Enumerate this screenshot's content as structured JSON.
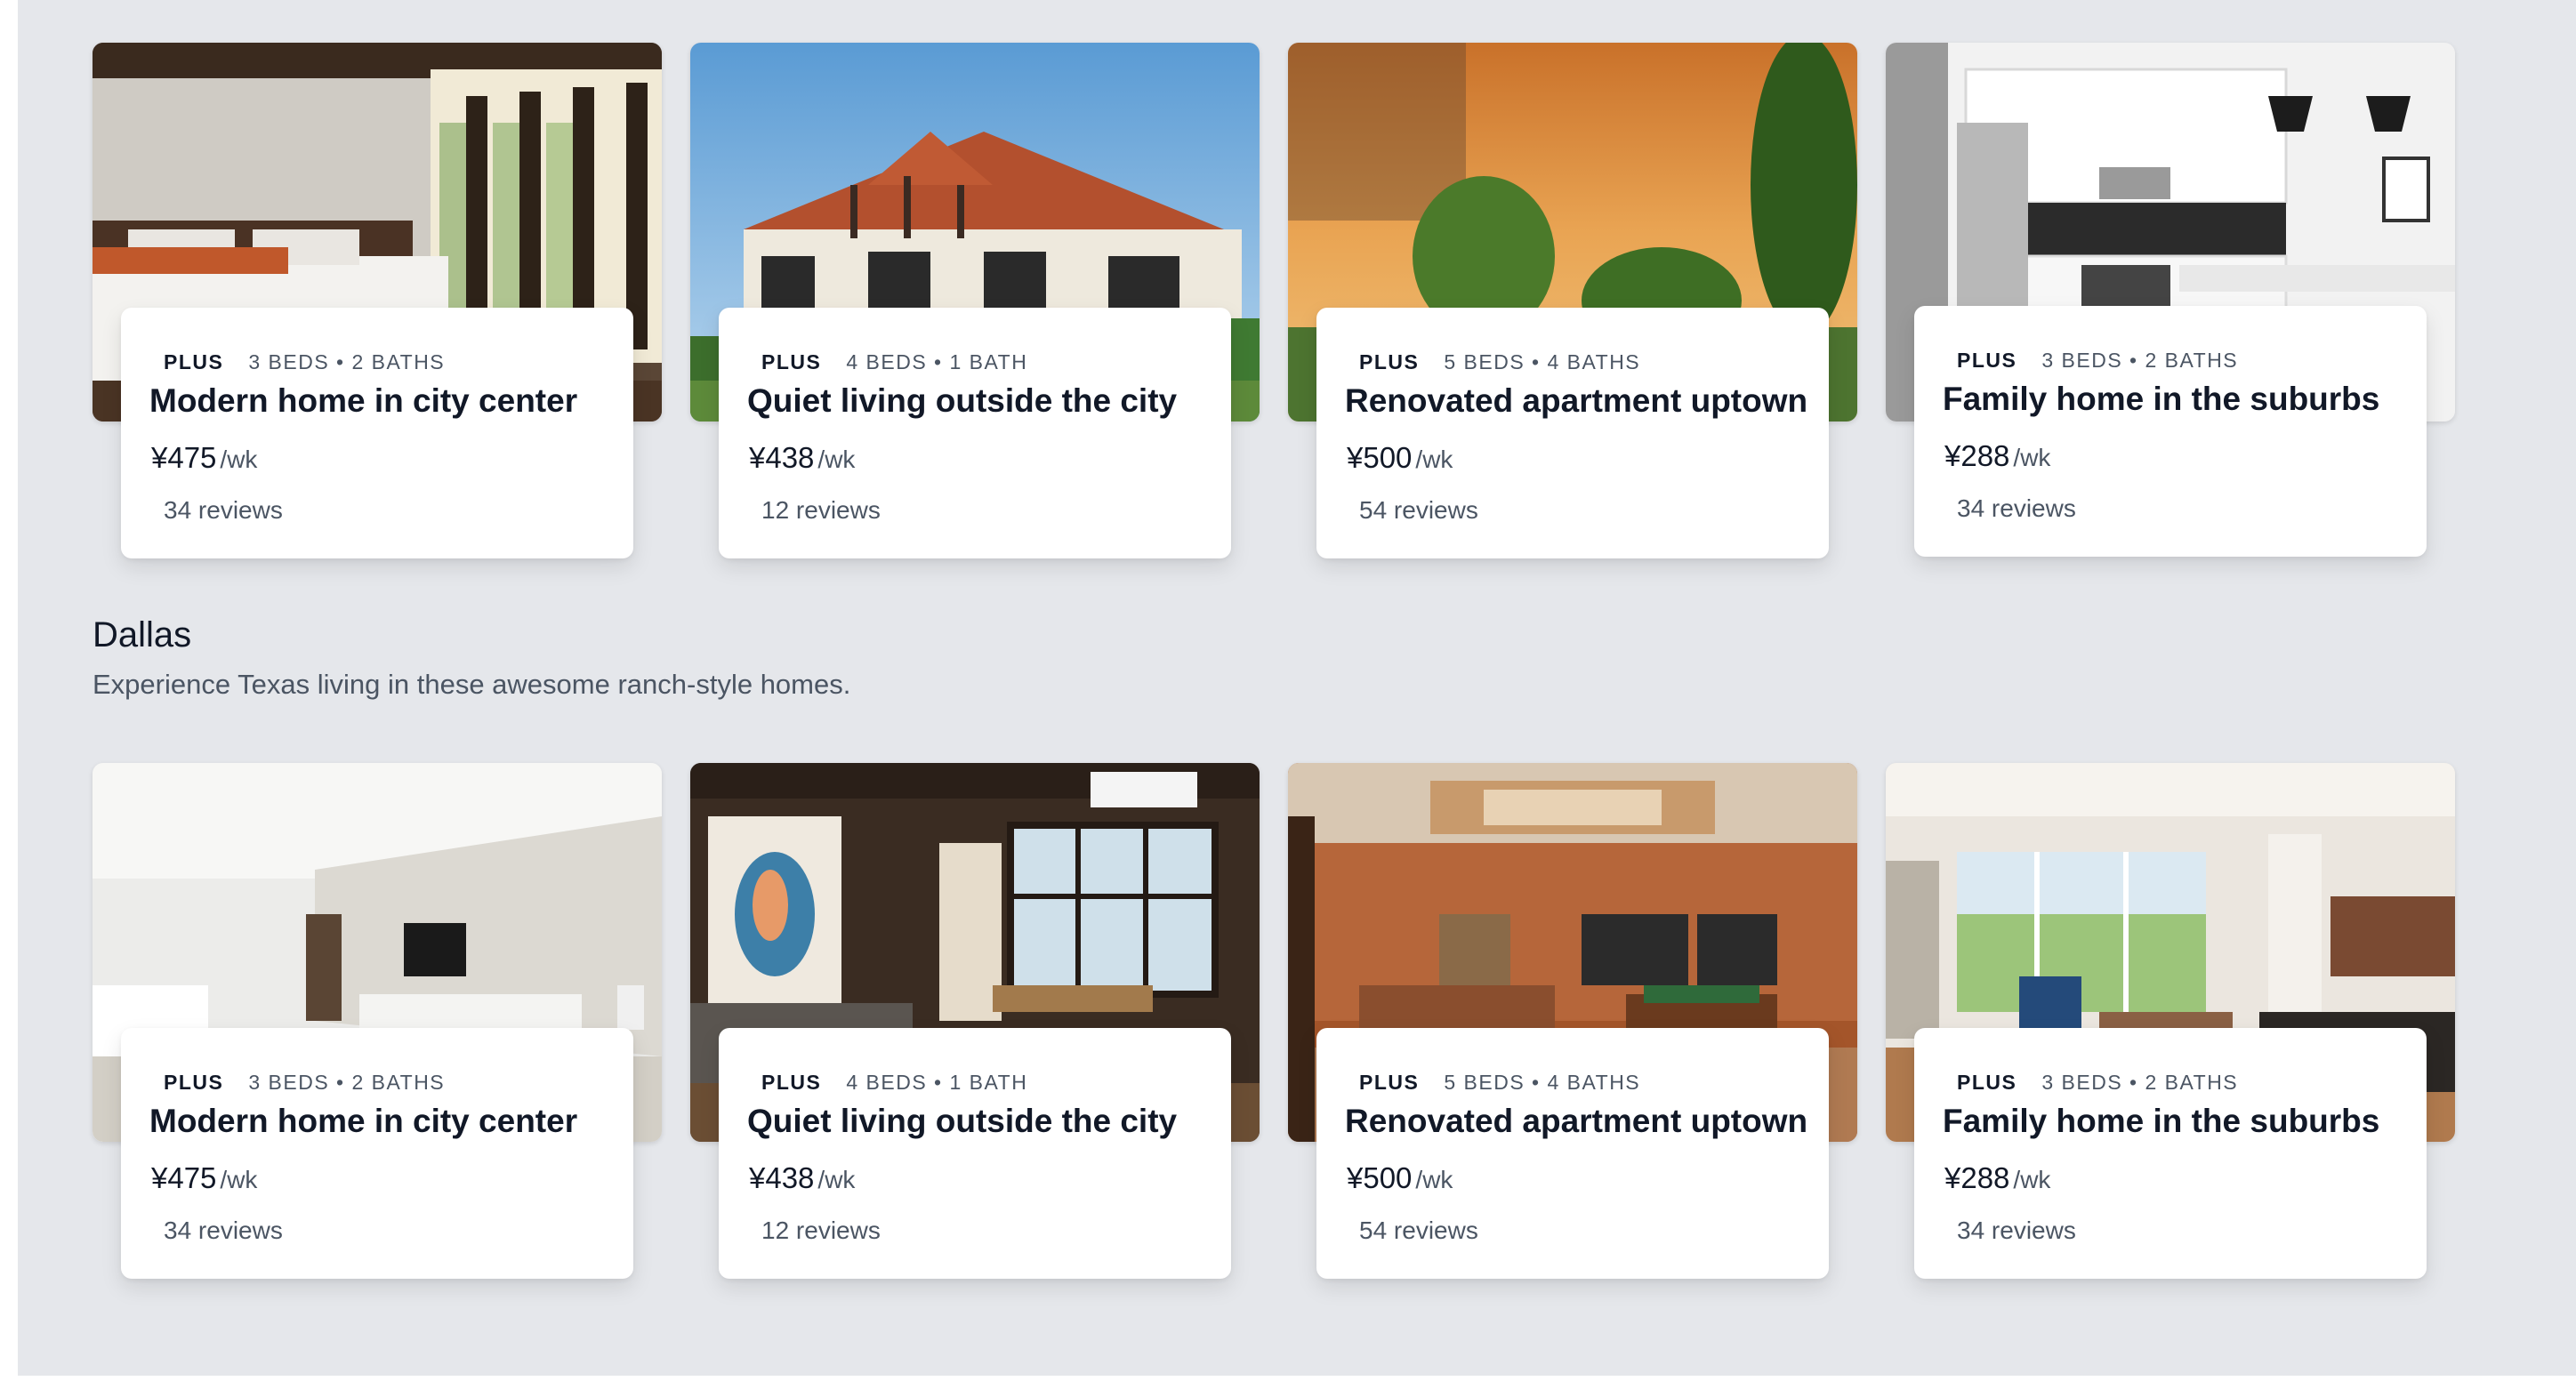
{
  "currency_symbol": "¥",
  "rows": [
    {
      "listings": [
        {
          "badge": "PLUS",
          "specs": "3 BEDS • 2 BATHS",
          "title": "Modern home in city center",
          "price": "¥475",
          "per": "/wk",
          "reviews": "34 reviews",
          "photo": "bedroom with sunlit windows"
        },
        {
          "badge": "PLUS",
          "specs": "4 BEDS • 1 BATH",
          "title": "Quiet living outside the city",
          "price": "¥438",
          "per": "/wk",
          "reviews": "12 reviews",
          "photo": "tudor style house under blue sky"
        },
        {
          "badge": "PLUS",
          "specs": "5 BEDS • 4 BATHS",
          "title": "Renovated apartment uptown",
          "price": "¥500",
          "per": "/wk",
          "reviews": "54 reviews",
          "photo": "trees at orange sunset"
        },
        {
          "badge": "PLUS",
          "specs": "3 BEDS • 2 BATHS",
          "title": "Family home in the suburbs",
          "price": "¥288",
          "per": "/wk",
          "reviews": "34 reviews",
          "photo": "white modern kitchen"
        }
      ]
    },
    {
      "listings": [
        {
          "badge": "PLUS",
          "specs": "3 BEDS • 2 BATHS",
          "title": "Modern home in city center",
          "price": "¥475",
          "per": "/wk",
          "reviews": "34 reviews",
          "photo": "white minimalist bedroom"
        },
        {
          "badge": "PLUS",
          "specs": "4 BEDS • 1 BATH",
          "title": "Quiet living outside the city",
          "price": "¥438",
          "per": "/wk",
          "reviews": "12 reviews",
          "photo": "living room with artwork"
        },
        {
          "badge": "PLUS",
          "specs": "5 BEDS • 4 BATHS",
          "title": "Renovated apartment uptown",
          "price": "¥500",
          "per": "/wk",
          "reviews": "54 reviews",
          "photo": "game room with pool table"
        },
        {
          "badge": "PLUS",
          "specs": "3 BEDS • 2 BATHS",
          "title": "Family home in the suburbs",
          "price": "¥288",
          "per": "/wk",
          "reviews": "34 reviews",
          "photo": "bright living room"
        }
      ]
    }
  ],
  "section": {
    "heading": "Dallas",
    "description": "Experience Texas living in these awesome ranch-style homes."
  }
}
